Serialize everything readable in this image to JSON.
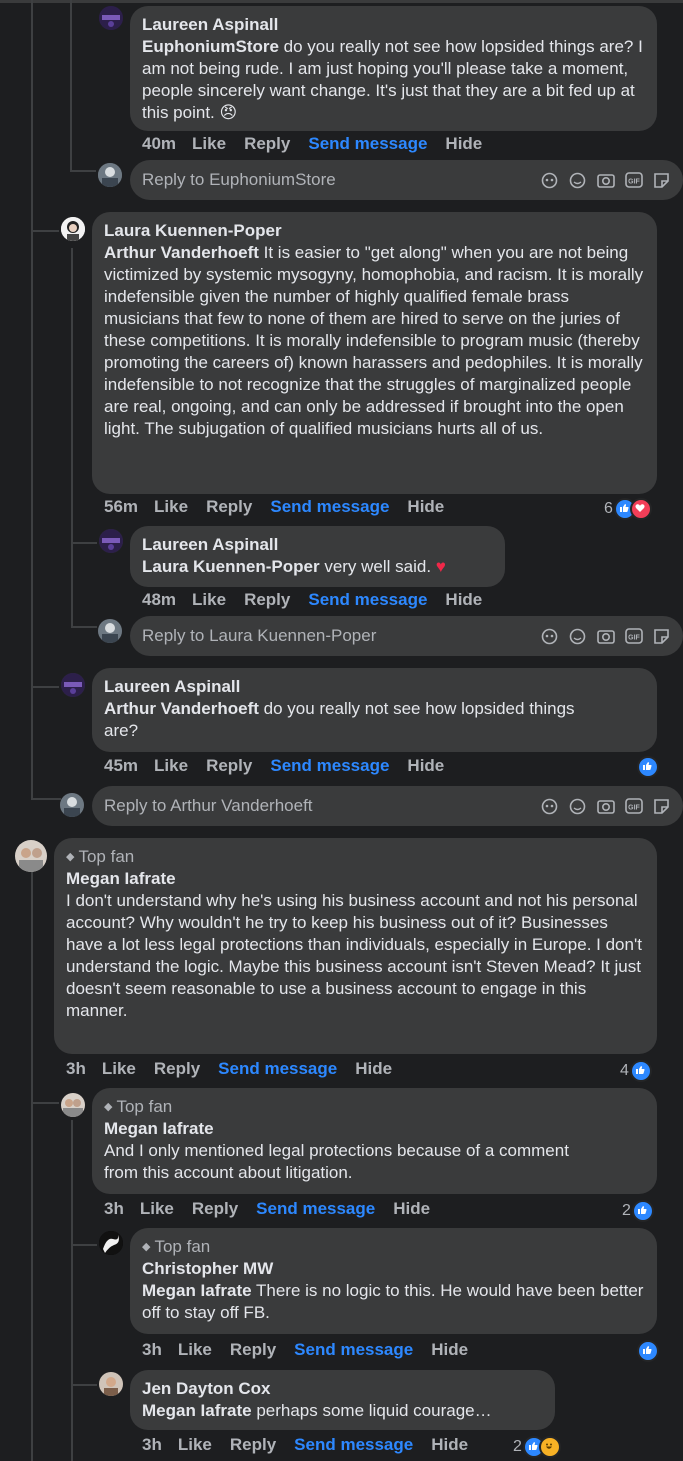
{
  "comments": [
    {
      "author": "Laureen Aspinall",
      "mention": "EuphoniumStore",
      "text": " do you really not see how lopsided things are? I am not being rude. I am just hoping you'll please take a moment, people sincerely want change. It's just that they are a bit fed up at this point. ",
      "emoji": "😠",
      "time": "40m"
    },
    {
      "author": "Laura Kuennen-Poper",
      "mention": "Arthur Vanderhoeft",
      "text": " It is easier to \"get along\" when you are not being victimized by systemic mysogyny, homophobia, and racism. It is morally indefensible given the number of highly qualified female brass musicians that few to none of them are hired to serve on the juries of these competitions. It is morally indefensible to program music (thereby promoting the careers of) known harassers and pedophiles. It is morally indefensible to not recognize that the struggles of marginalized people are real, ongoing, and can only be addressed if brought into the open light. The subjugation of qualified musicians hurts all of us.",
      "time": "56m",
      "reaction_count": "6"
    },
    {
      "author": "Laureen Aspinall",
      "mention": "Laura Kuennen-Poper",
      "text": " very well said. ",
      "emoji": "♥",
      "time": "48m"
    },
    {
      "author": "Laureen Aspinall",
      "mention": "Arthur Vanderhoeft",
      "text": " do you really not see how lopsided things are?",
      "time": "45m"
    },
    {
      "badge": "Top fan",
      "author": "Megan Iafrate",
      "text": "I don't understand why he's using his business account and not his personal account? Why wouldn't he try to keep his business out of it? Businesses have a lot less legal protections than individuals, especially in Europe. I don't understand the logic. Maybe this business account isn't Steven Mead? It just doesn't seem reasonable to use a business account to engage in this manner.",
      "time": "3h",
      "reaction_count": "4"
    },
    {
      "badge": "Top fan",
      "author": "Megan Iafrate",
      "text": "And I only mentioned legal protections because of a comment from this account about litigation.",
      "time": "3h",
      "reaction_count": "2"
    },
    {
      "badge": "Top fan",
      "author": "Christopher MW",
      "mention": "Megan Iafrate",
      "text": " There is no logic to this. He would have been better off to stay off FB.",
      "time": "3h"
    },
    {
      "author": "Jen Dayton Cox",
      "mention": "Megan Iafrate",
      "text": " perhaps some liquid courage…",
      "time": "3h",
      "reaction_count": "2"
    }
  ],
  "actions": {
    "like": "Like",
    "reply": "Reply",
    "send": "Send message",
    "hide": "Hide"
  },
  "reply_boxes": [
    {
      "placeholder": "Reply to EuphoniumStore"
    },
    {
      "placeholder": "Reply to Laura Kuennen-Poper"
    },
    {
      "placeholder": "Reply to Arthur Vanderhoeft"
    }
  ],
  "colors": {
    "background": "#1d1e20",
    "bubble": "#3a3b3c",
    "link": "#2d88ff",
    "muted": "#b0b3b8",
    "text": "#e4e6eb"
  }
}
